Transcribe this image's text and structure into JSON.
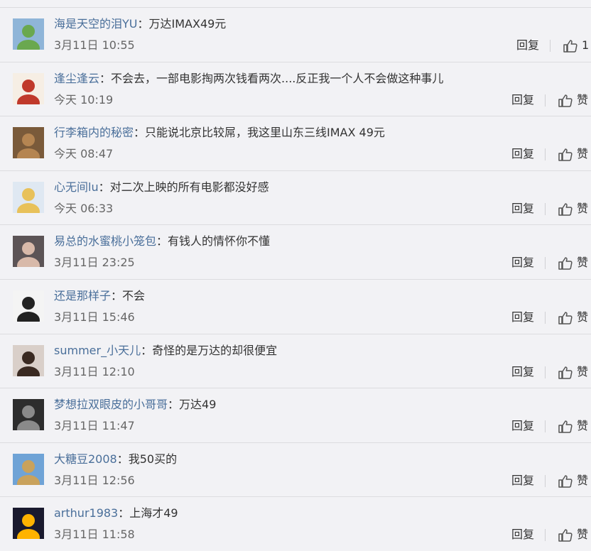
{
  "comments": [
    {
      "user": "海是天空的泪YU",
      "text": "万达IMAX49元",
      "time": "3月11日 10:55",
      "reply": "回复",
      "like": "1",
      "avatar": {
        "icon": "landscape-photo-avatar",
        "bg": "#8fb5d8",
        "fg": "#6aa84f"
      }
    },
    {
      "user": "逢尘逢云",
      "text": "不会去，一部电影掏两次钱看两次....反正我一个人不会做这种事儿",
      "time": "今天 10:19",
      "reply": "回复",
      "like": "赞",
      "avatar": {
        "icon": "cartoon-girl-avatar",
        "bg": "#f6eee4",
        "fg": "#c0392b"
      }
    },
    {
      "user": "行李箱内的秘密",
      "text": "只能说北京比较屌，我这里山东三线IMAX 49元",
      "time": "今天 08:47",
      "reply": "回复",
      "like": "赞",
      "avatar": {
        "icon": "cat-photo-avatar",
        "bg": "#7a5a3a",
        "fg": "#b58552"
      }
    },
    {
      "user": "心无间lu",
      "text": "对二次上映的所有电影都没好感",
      "time": "今天 06:33",
      "reply": "回复",
      "like": "赞",
      "avatar": {
        "icon": "anime-girl-avatar",
        "bg": "#dfe8f2",
        "fg": "#e8c15a"
      }
    },
    {
      "user": "易总的水蜜桃小笼包",
      "text": "有钱人的情怀你不懂",
      "time": "3月11日 23:25",
      "reply": "回复",
      "like": "赞",
      "avatar": {
        "icon": "portrait-photo-avatar",
        "bg": "#5c5456",
        "fg": "#d8b9a9"
      }
    },
    {
      "user": "还是那样子",
      "text": "不会",
      "time": "3月11日 15:46",
      "reply": "回复",
      "like": "赞",
      "avatar": {
        "icon": "sketch-portrait-avatar",
        "bg": "#f4f4f4",
        "fg": "#222222"
      }
    },
    {
      "user": "summer_小天儿",
      "text": "奇怪的是万达的却很便宜",
      "time": "3月11日 12:10",
      "reply": "回复",
      "like": "赞",
      "avatar": {
        "icon": "selfie-photo-avatar",
        "bg": "#d9cfc9",
        "fg": "#3a2a22"
      }
    },
    {
      "user": "梦想拉双眼皮的小哥哥",
      "text": "万达49",
      "time": "3月11日 11:47",
      "reply": "回复",
      "like": "赞",
      "avatar": {
        "icon": "helmet-photo-avatar",
        "bg": "#2d2d2d",
        "fg": "#8a8a8a"
      }
    },
    {
      "user": "大糖豆2008",
      "text": "我50买的",
      "time": "3月11日 12:56",
      "reply": "回复",
      "like": "赞",
      "avatar": {
        "icon": "sky-photo-avatar",
        "bg": "#6fa3d6",
        "fg": "#c9a25c"
      }
    },
    {
      "user": "arthur1983",
      "text": "上海才49",
      "time": "3月11日 11:58",
      "reply": "回复",
      "like": "赞",
      "avatar": {
        "icon": "fire-photo-avatar",
        "bg": "#1a1a2e",
        "fg": "#ffb300"
      }
    }
  ]
}
